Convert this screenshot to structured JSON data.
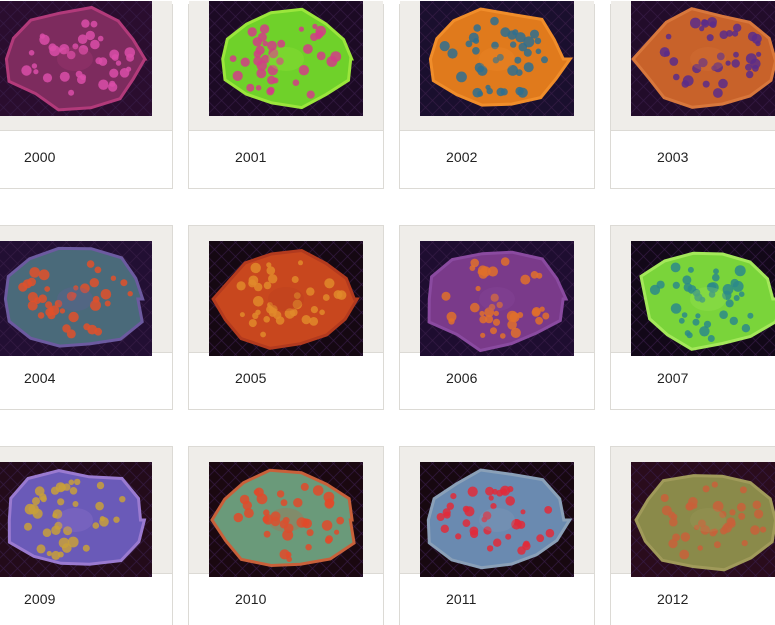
{
  "gallery": {
    "items": [
      {
        "label": "2000",
        "colors": {
          "bg": "#2a0d2e",
          "base": "#7d2b5e",
          "spot": "#d94ea8",
          "rim": "#b23a7a"
        }
      },
      {
        "label": "2001",
        "colors": {
          "bg": "#1c0a24",
          "base": "#6fd12a",
          "spot": "#d23d86",
          "rim": "#9be63c"
        }
      },
      {
        "label": "2002",
        "colors": {
          "bg": "#1a0f2e",
          "base": "#e07a1c",
          "spot": "#2e6f8f",
          "rim": "#f08d2a"
        }
      },
      {
        "label": "2003",
        "colors": {
          "bg": "#220c2a",
          "base": "#c8622a",
          "spot": "#5b2d8a",
          "rim": "#d8773c"
        }
      },
      {
        "label": "2004",
        "colors": {
          "bg": "#220f33",
          "base": "#4a6a7a",
          "spot": "#e0502a",
          "rim": "#6c5aa0"
        }
      },
      {
        "label": "2005",
        "colors": {
          "bg": "#150812",
          "base": "#c8471e",
          "spot": "#e08a2a",
          "rim": "#b23a1e"
        }
      },
      {
        "label": "2006",
        "colors": {
          "bg": "#1e0d30",
          "base": "#7a3a8a",
          "spot": "#e0702a",
          "rim": "#8a4aa0"
        }
      },
      {
        "label": "2007",
        "colors": {
          "bg": "#120818",
          "base": "#7ad43a",
          "spot": "#2c8a8a",
          "rim": "#a4e85a"
        }
      },
      {
        "label": "2009",
        "colors": {
          "bg": "#230b1a",
          "base": "#6a5ab8",
          "spot": "#c8a03a",
          "rim": "#9a7ad0"
        }
      },
      {
        "label": "2010",
        "colors": {
          "bg": "#1a0810",
          "base": "#6a9a7a",
          "spot": "#e04a2a",
          "rim": "#c8603a"
        }
      },
      {
        "label": "2011",
        "colors": {
          "bg": "#170810",
          "base": "#6a8ab0",
          "spot": "#e02a3a",
          "rim": "#8aa0b8"
        }
      },
      {
        "label": "2012",
        "colors": {
          "bg": "#2a0c1c",
          "base": "#8a8a4a",
          "spot": "#c8603a",
          "rim": "#a09a5a"
        }
      }
    ]
  }
}
